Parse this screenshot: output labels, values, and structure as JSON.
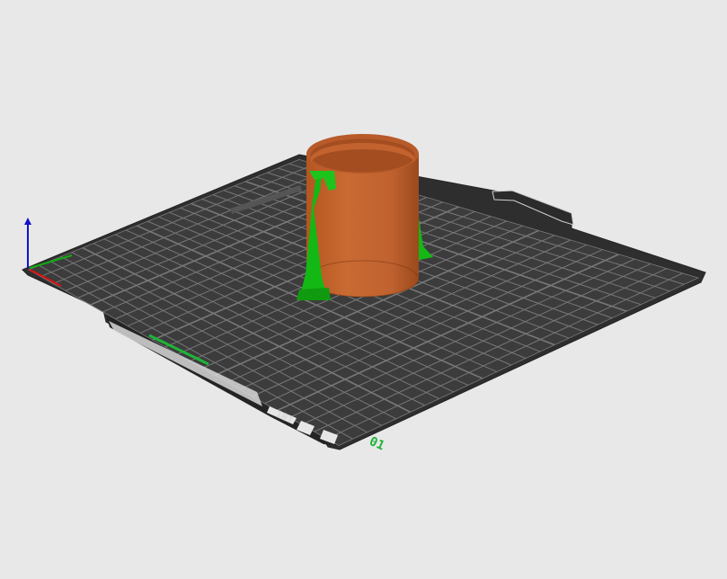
{
  "viewport": {
    "background": "#e8e8e8"
  },
  "bed": {
    "surface_color": "#3c3c3c",
    "frame_color": "#2f2f2f",
    "grid_color": "#8a8a8a",
    "label_front": "01",
    "label_front_color": "#1fb33a",
    "label_small": "101"
  },
  "model": {
    "body_color": "#c0622f",
    "inner_color": "#a84f22",
    "support_color": "#14b814"
  },
  "axes": {
    "x_color": "#d11",
    "y_color": "#1a1",
    "z_color": "#11c",
    "icon": "axes-gizmo-icon"
  }
}
